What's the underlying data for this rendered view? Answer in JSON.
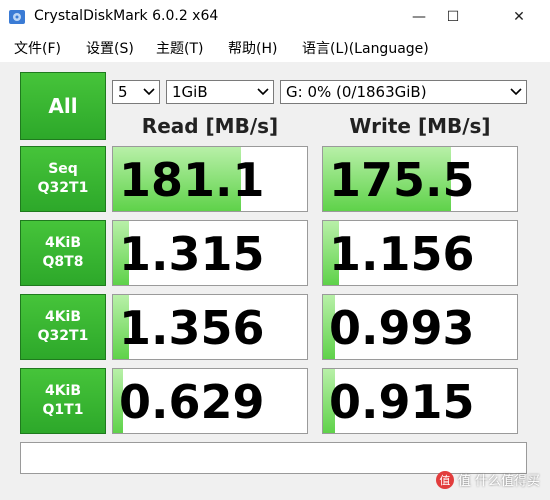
{
  "window": {
    "title": "CrystalDiskMark 6.0.2 x64",
    "minimize_glyph": "—",
    "maximize_glyph": "☐",
    "close_glyph": "✕"
  },
  "menu": [
    {
      "label": "文件(F)"
    },
    {
      "label": "设置(S)"
    },
    {
      "label": "主题(T)"
    },
    {
      "label": "帮助(H)"
    },
    {
      "label": "语言(L)(Language)"
    }
  ],
  "controls": {
    "all_button": "All",
    "count": "5",
    "size": "1GiB",
    "drive": "G: 0% (0/1863GiB)"
  },
  "headers": {
    "read": "Read [MB/s]",
    "write": "Write [MB/s]"
  },
  "tests": [
    {
      "line1": "Seq",
      "line2": "Q32T1",
      "read": "181.1",
      "read_fill": 0.66,
      "write": "175.5",
      "write_fill": 0.66
    },
    {
      "line1": "4KiB",
      "line2": "Q8T8",
      "read": "1.315",
      "read_fill": 0.08,
      "write": "1.156",
      "write_fill": 0.08
    },
    {
      "line1": "4KiB",
      "line2": "Q32T1",
      "read": "1.356",
      "read_fill": 0.08,
      "write": "0.993",
      "write_fill": 0.06
    },
    {
      "line1": "4KiB",
      "line2": "Q1T1",
      "read": "0.629",
      "read_fill": 0.05,
      "write": "0.915",
      "write_fill": 0.06
    }
  ],
  "comment": "",
  "watermark": {
    "text": "值 什么值得买",
    "icon_text": "值"
  },
  "colors": {
    "button_green": "#2da82a",
    "bar_green": "#5fd24a"
  }
}
